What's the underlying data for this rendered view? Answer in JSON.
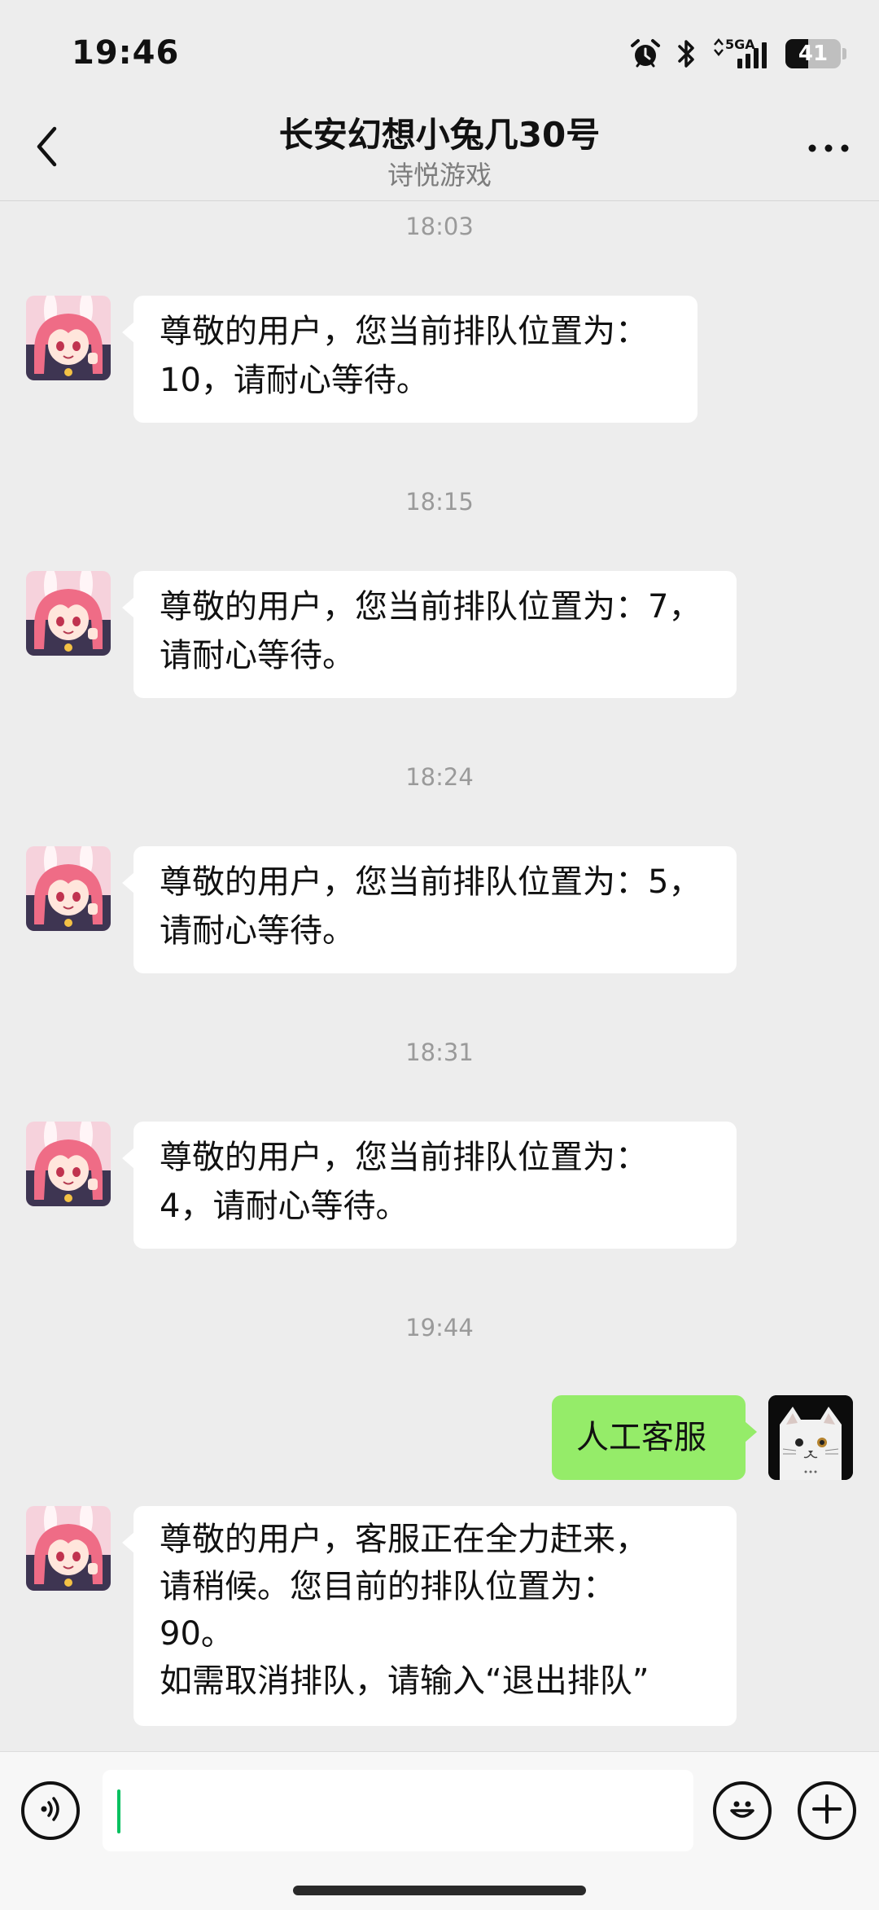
{
  "status_bar": {
    "time": "19:46",
    "network": "5GA",
    "battery": "41",
    "battery_level": 0.41
  },
  "header": {
    "title": "长安幻想小兔几30号",
    "subtitle": "诗悦游戏"
  },
  "messages": [
    {
      "timestamp": "18:03",
      "text": "尊敬的用户，您当前排队位置为：\n10，请耐心等待。"
    },
    {
      "timestamp": "18:15",
      "text": "尊敬的用户，您当前排队位置为：7，\n请耐心等待。"
    },
    {
      "timestamp": "18:24",
      "text": "尊敬的用户，您当前排队位置为：5，\n请耐心等待。"
    },
    {
      "timestamp": "18:31",
      "text": "尊敬的用户，您当前排队位置为：\n4，请耐心等待。"
    },
    {
      "timestamp": "19:44",
      "text": "人工客服"
    },
    {
      "text": "尊敬的用户，客服正在全力赶来，\n请稍候。您目前的排队位置为：\n90。\n如需取消排队，请输入“退出排队”"
    }
  ],
  "input": {
    "value": "",
    "placeholder": ""
  },
  "icons": {
    "back": "chevron-left-icon",
    "more": "more-dots-icon",
    "voice": "voice-icon",
    "emoji": "emoji-icon",
    "plus": "plus-icon"
  },
  "colors": {
    "background": "#ededed",
    "incoming_bubble": "#ffffff",
    "outgoing_bubble": "#95ec69",
    "caret": "#07c160"
  }
}
